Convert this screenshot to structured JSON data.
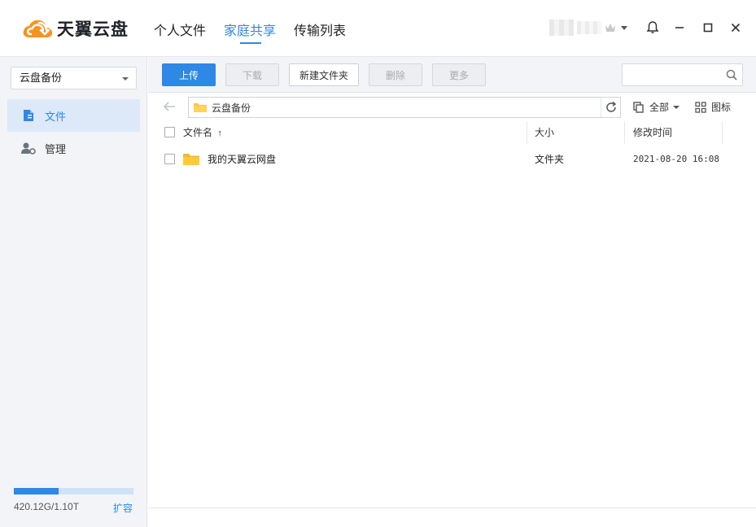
{
  "app": {
    "brand": "天翼云盘"
  },
  "nav_tabs": [
    {
      "label": "个人文件"
    },
    {
      "label": "家庭共享",
      "active": true
    },
    {
      "label": "传输列表"
    }
  ],
  "sidebar": {
    "selector_value": "云盘备份",
    "items": [
      {
        "label": "文件",
        "icon": "file-doc-icon",
        "active": true
      },
      {
        "label": "管理",
        "icon": "user-manage-icon"
      }
    ],
    "storage": {
      "text": "420.12G/1.10T",
      "used_fraction": 0.3729,
      "expand_label": "扩容"
    }
  },
  "toolbar": {
    "upload": "上传",
    "download": "下载",
    "new_folder": "新建文件夹",
    "delete": "删除",
    "more": "更多",
    "search_placeholder": ""
  },
  "pathbar": {
    "path": "云盘备份",
    "filter_label": "全部",
    "view_label": "图标"
  },
  "table": {
    "columns": {
      "name": "文件名",
      "sort_indicator": "↑",
      "size": "大小",
      "modified": "修改时间"
    },
    "rows": [
      {
        "name": "我的天翼云网盘",
        "size": "文件夹",
        "modified": "2021-08-20 16:08"
      }
    ]
  },
  "colors": {
    "accent": "#2f87e6",
    "sidebar_bg": "#f2f4f7",
    "folder": "#ffc83d"
  }
}
